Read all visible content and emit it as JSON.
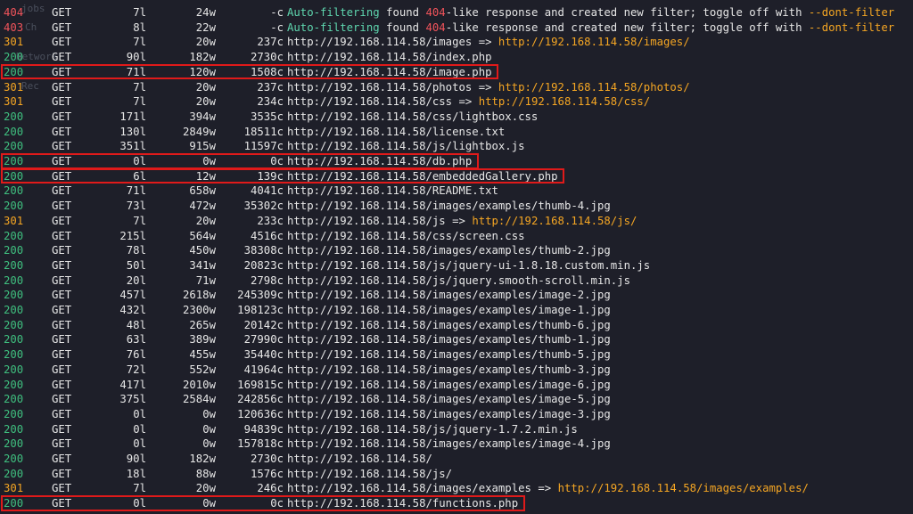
{
  "background_fragments": {
    "a": "jobs",
    "b": "Ch",
    "c": "Network",
    "d": "Rec"
  },
  "filter_rows": [
    {
      "status": "404",
      "method": "GET",
      "lines": "7l",
      "words": "24w",
      "chars": "-c",
      "prefix": "Auto-filtering",
      "t1": " found ",
      "code": "404",
      "t2": "-like response and created new filter; toggle off with ",
      "flag": "--dont-filter"
    },
    {
      "status": "403",
      "method": "GET",
      "lines": "8l",
      "words": "22w",
      "chars": "-c",
      "prefix": "Auto-filtering",
      "t1": " found ",
      "code": "404",
      "t2": "-like response and created new filter; toggle off with ",
      "flag": "--dont-filter"
    }
  ],
  "rows": [
    {
      "status": "301",
      "method": "GET",
      "lines": "7l",
      "words": "20w",
      "chars": "237c",
      "url": "http://192.168.114.58/images",
      "redirect": "http://192.168.114.58/images/"
    },
    {
      "status": "200",
      "method": "GET",
      "lines": "90l",
      "words": "182w",
      "chars": "2730c",
      "url": "http://192.168.114.58/index.php"
    },
    {
      "status": "200",
      "method": "GET",
      "lines": "71l",
      "words": "120w",
      "chars": "1508c",
      "url": "http://192.168.114.58/image.php",
      "highlight": true
    },
    {
      "status": "301",
      "method": "GET",
      "lines": "7l",
      "words": "20w",
      "chars": "237c",
      "url": "http://192.168.114.58/photos",
      "redirect": "http://192.168.114.58/photos/"
    },
    {
      "status": "301",
      "method": "GET",
      "lines": "7l",
      "words": "20w",
      "chars": "234c",
      "url": "http://192.168.114.58/css",
      "redirect": "http://192.168.114.58/css/"
    },
    {
      "status": "200",
      "method": "GET",
      "lines": "171l",
      "words": "394w",
      "chars": "3535c",
      "url": "http://192.168.114.58/css/lightbox.css"
    },
    {
      "status": "200",
      "method": "GET",
      "lines": "130l",
      "words": "2849w",
      "chars": "18511c",
      "url": "http://192.168.114.58/license.txt"
    },
    {
      "status": "200",
      "method": "GET",
      "lines": "351l",
      "words": "915w",
      "chars": "11597c",
      "url": "http://192.168.114.58/js/lightbox.js"
    },
    {
      "status": "200",
      "method": "GET",
      "lines": "0l",
      "words": "0w",
      "chars": "0c",
      "url": "http://192.168.114.58/db.php",
      "highlight": true
    },
    {
      "status": "200",
      "method": "GET",
      "lines": "6l",
      "words": "12w",
      "chars": "139c",
      "url": "http://192.168.114.58/embeddedGallery.php",
      "highlight": true
    },
    {
      "status": "200",
      "method": "GET",
      "lines": "71l",
      "words": "658w",
      "chars": "4041c",
      "url": "http://192.168.114.58/README.txt"
    },
    {
      "status": "200",
      "method": "GET",
      "lines": "73l",
      "words": "472w",
      "chars": "35302c",
      "url": "http://192.168.114.58/images/examples/thumb-4.jpg"
    },
    {
      "status": "301",
      "method": "GET",
      "lines": "7l",
      "words": "20w",
      "chars": "233c",
      "url": "http://192.168.114.58/js",
      "redirect": "http://192.168.114.58/js/"
    },
    {
      "status": "200",
      "method": "GET",
      "lines": "215l",
      "words": "564w",
      "chars": "4516c",
      "url": "http://192.168.114.58/css/screen.css"
    },
    {
      "status": "200",
      "method": "GET",
      "lines": "78l",
      "words": "450w",
      "chars": "38308c",
      "url": "http://192.168.114.58/images/examples/thumb-2.jpg"
    },
    {
      "status": "200",
      "method": "GET",
      "lines": "50l",
      "words": "341w",
      "chars": "20823c",
      "url": "http://192.168.114.58/js/jquery-ui-1.8.18.custom.min.js"
    },
    {
      "status": "200",
      "method": "GET",
      "lines": "20l",
      "words": "71w",
      "chars": "2798c",
      "url": "http://192.168.114.58/js/jquery.smooth-scroll.min.js"
    },
    {
      "status": "200",
      "method": "GET",
      "lines": "457l",
      "words": "2618w",
      "chars": "245309c",
      "url": "http://192.168.114.58/images/examples/image-2.jpg"
    },
    {
      "status": "200",
      "method": "GET",
      "lines": "432l",
      "words": "2300w",
      "chars": "198123c",
      "url": "http://192.168.114.58/images/examples/image-1.jpg"
    },
    {
      "status": "200",
      "method": "GET",
      "lines": "48l",
      "words": "265w",
      "chars": "20142c",
      "url": "http://192.168.114.58/images/examples/thumb-6.jpg"
    },
    {
      "status": "200",
      "method": "GET",
      "lines": "63l",
      "words": "389w",
      "chars": "27990c",
      "url": "http://192.168.114.58/images/examples/thumb-1.jpg"
    },
    {
      "status": "200",
      "method": "GET",
      "lines": "76l",
      "words": "455w",
      "chars": "35440c",
      "url": "http://192.168.114.58/images/examples/thumb-5.jpg"
    },
    {
      "status": "200",
      "method": "GET",
      "lines": "72l",
      "words": "552w",
      "chars": "41964c",
      "url": "http://192.168.114.58/images/examples/thumb-3.jpg"
    },
    {
      "status": "200",
      "method": "GET",
      "lines": "417l",
      "words": "2010w",
      "chars": "169815c",
      "url": "http://192.168.114.58/images/examples/image-6.jpg"
    },
    {
      "status": "200",
      "method": "GET",
      "lines": "375l",
      "words": "2584w",
      "chars": "242856c",
      "url": "http://192.168.114.58/images/examples/image-5.jpg"
    },
    {
      "status": "200",
      "method": "GET",
      "lines": "0l",
      "words": "0w",
      "chars": "120636c",
      "url": "http://192.168.114.58/images/examples/image-3.jpg"
    },
    {
      "status": "200",
      "method": "GET",
      "lines": "0l",
      "words": "0w",
      "chars": "94839c",
      "url": "http://192.168.114.58/js/jquery-1.7.2.min.js"
    },
    {
      "status": "200",
      "method": "GET",
      "lines": "0l",
      "words": "0w",
      "chars": "157818c",
      "url": "http://192.168.114.58/images/examples/image-4.jpg"
    },
    {
      "status": "200",
      "method": "GET",
      "lines": "90l",
      "words": "182w",
      "chars": "2730c",
      "url": "http://192.168.114.58/"
    },
    {
      "status": "200",
      "method": "GET",
      "lines": "18l",
      "words": "88w",
      "chars": "1576c",
      "url": "http://192.168.114.58/js/"
    },
    {
      "status": "301",
      "method": "GET",
      "lines": "7l",
      "words": "20w",
      "chars": "246c",
      "url": "http://192.168.114.58/images/examples",
      "redirect": "http://192.168.114.58/images/examples/"
    },
    {
      "status": "200",
      "method": "GET",
      "lines": "0l",
      "words": "0w",
      "chars": "0c",
      "url": "http://192.168.114.58/functions.php",
      "highlight": true
    }
  ],
  "arrow": "=>",
  "colors": {
    "background": "#1e1f29",
    "status_200": "#3fbf7f",
    "status_301": "#f5a623",
    "status_4xx": "#f2545b",
    "highlight_box": "#e01a1a",
    "text": "#e6e6e6"
  }
}
